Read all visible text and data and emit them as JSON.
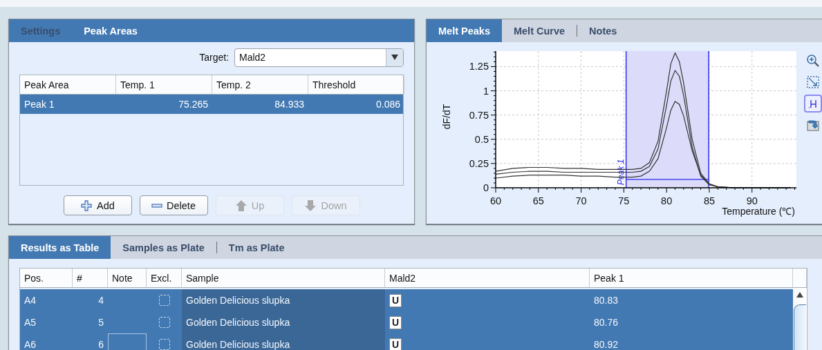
{
  "settings_panel": {
    "tabs": [
      {
        "label": "Settings",
        "selected": false
      },
      {
        "label": "Peak Areas",
        "selected": true
      }
    ],
    "target": {
      "label": "Target:",
      "value": "Mald2"
    },
    "table": {
      "columns": [
        "Peak Area",
        "Temp. 1",
        "Temp. 2",
        "Threshold"
      ],
      "rows": [
        {
          "cells": [
            "Peak 1",
            "75.265",
            "84.933",
            "0.086"
          ],
          "selected": true
        }
      ]
    },
    "buttons": [
      {
        "label": "Add",
        "kind": "plus",
        "disabled": false
      },
      {
        "label": "Delete",
        "kind": "minus",
        "disabled": false
      },
      {
        "label": "Up",
        "kind": "up",
        "disabled": true
      },
      {
        "label": "Down",
        "kind": "down",
        "disabled": true
      }
    ]
  },
  "chart_panel": {
    "tabs": [
      {
        "label": "Melt Peaks",
        "selected": true
      },
      {
        "label": "Melt Curve",
        "selected": false
      },
      {
        "label": "Notes",
        "selected": false
      }
    ],
    "tools": [
      {
        "kind": "zoom",
        "selected": false
      },
      {
        "kind": "zoom-box",
        "selected": false
      },
      {
        "kind": "peak",
        "selected": true
      },
      {
        "kind": "export",
        "selected": false
      }
    ],
    "chart_data": {
      "type": "line",
      "xlabel": "Temperature (℃)",
      "ylabel": "dF/dT",
      "x": [
        60,
        62,
        64,
        66,
        68,
        70,
        72,
        74,
        76,
        77,
        78,
        79,
        80,
        80.5,
        81,
        81.5,
        82,
        83,
        84,
        85,
        86,
        88,
        90,
        92,
        94.5
      ],
      "series": [
        {
          "color": "#333333",
          "values": [
            0.17,
            0.2,
            0.21,
            0.21,
            0.2,
            0.2,
            0.19,
            0.19,
            0.19,
            0.2,
            0.26,
            0.48,
            1.0,
            1.28,
            1.39,
            1.3,
            1.08,
            0.5,
            0.15,
            0.04,
            0.01,
            0,
            0,
            0,
            0
          ]
        },
        {
          "color": "#333333",
          "values": [
            0.14,
            0.16,
            0.17,
            0.17,
            0.16,
            0.16,
            0.16,
            0.16,
            0.16,
            0.17,
            0.22,
            0.4,
            0.85,
            1.1,
            1.21,
            1.15,
            0.95,
            0.42,
            0.12,
            0.03,
            0.01,
            0,
            0,
            0,
            0
          ]
        },
        {
          "color": "#333333",
          "values": [
            0.1,
            0.12,
            0.13,
            0.13,
            0.13,
            0.12,
            0.12,
            0.11,
            0.11,
            0.12,
            0.17,
            0.3,
            0.62,
            0.8,
            0.89,
            0.86,
            0.74,
            0.38,
            0.13,
            0.04,
            0.01,
            0,
            0,
            0,
            0
          ]
        }
      ],
      "xlim": [
        60,
        95.2
      ],
      "ylim": [
        0,
        1.41
      ],
      "xticks": [
        60,
        65,
        70,
        75,
        80,
        85,
        90
      ],
      "yticks": [
        0,
        0.25,
        0.5,
        0.75,
        1,
        1.25
      ],
      "grid": true,
      "bands": [
        {
          "axis": "x",
          "from": 75.265,
          "to": 84.933,
          "label": "Peak 1"
        }
      ],
      "ref_lines": [
        {
          "axis": "x",
          "value": 75.265
        },
        {
          "axis": "x",
          "value": 84.933
        },
        {
          "axis": "y",
          "value": 0.086
        }
      ]
    }
  },
  "results_panel": {
    "tabs": [
      {
        "label": "Results as Table",
        "selected": true
      },
      {
        "label": "Samples as Plate",
        "selected": false
      },
      {
        "label": "Tm as Plate",
        "selected": false
      }
    ],
    "table": {
      "columns": [
        "Pos.",
        "#",
        "Note",
        "Excl.",
        "Sample",
        "Mald2",
        "Peak 1"
      ],
      "rows": [
        {
          "pos": "A4",
          "number": "4",
          "note_focused": false,
          "excluded": false,
          "sample": "Golden Delicious slupka",
          "call": "U",
          "peak": "80.83",
          "selected": true
        },
        {
          "pos": "A5",
          "number": "5",
          "note_focused": false,
          "excluded": false,
          "sample": "Golden Delicious slupka",
          "call": "U",
          "peak": "80.76",
          "selected": true
        },
        {
          "pos": "A6",
          "number": "6",
          "note_focused": true,
          "excluded": false,
          "sample": "Golden Delicious slupka",
          "call": "U",
          "peak": "80.92",
          "selected": true
        }
      ]
    }
  }
}
